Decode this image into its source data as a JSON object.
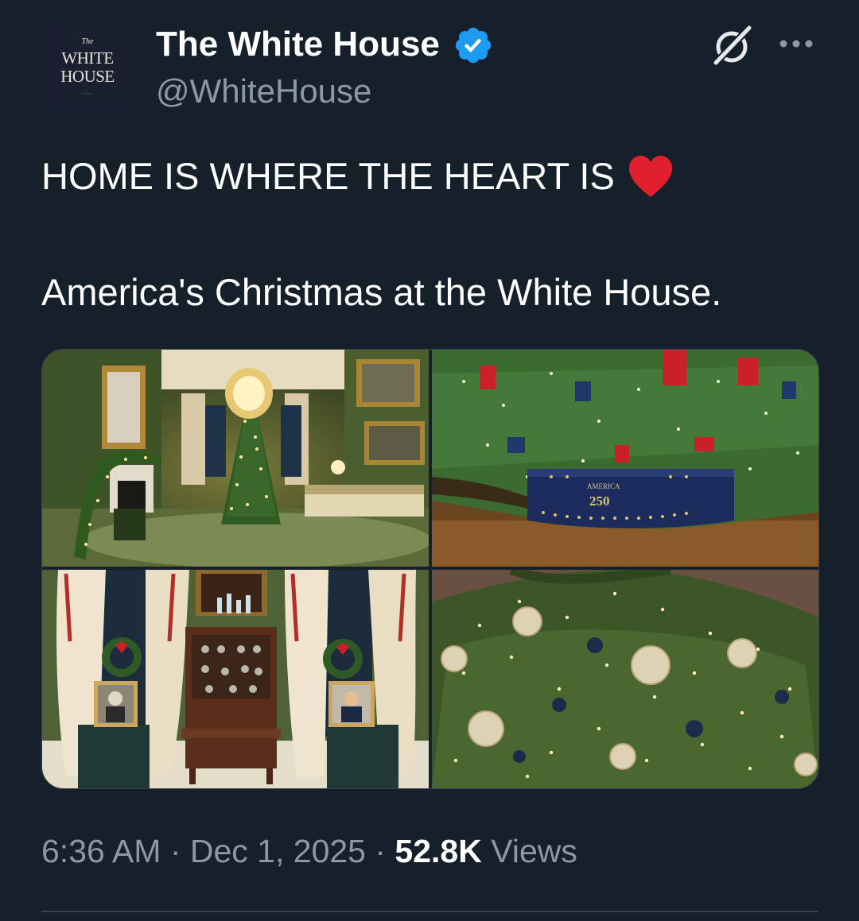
{
  "author": {
    "avatar_lines": [
      "The",
      "WHITE",
      "HOUSE"
    ],
    "display_name": "The White House",
    "handle": "@WhiteHouse",
    "verified_icon": "verified-badge-icon"
  },
  "actions": {
    "grok_icon": "grok-icon",
    "more_icon": "more-options-icon"
  },
  "post": {
    "line1": "HOME IS WHERE THE HEART IS",
    "emoji": "red-heart",
    "line2": "America's Christmas at the White House."
  },
  "media": {
    "photo_count": 4,
    "photos": [
      {
        "alt_icon": "green-room-christmas-tree-photo"
      },
      {
        "alt_icon": "tree-skirt-america-250-photo",
        "text": [
          "AMERICA",
          "250"
        ]
      },
      {
        "alt_icon": "portraits-and-cabinet-photo"
      },
      {
        "alt_icon": "tree-ornaments-closeup-photo"
      }
    ]
  },
  "meta": {
    "time": "6:36 AM",
    "sep1": " · ",
    "date": "Dec 1, 2025",
    "sep2": " · ",
    "views_count": "52.8K",
    "views_label": " Views"
  },
  "colors": {
    "background": "#15202b",
    "muted_text": "#8b98a5",
    "verified_blue": "#1d9bf0",
    "heart_red": "#e0202e"
  }
}
